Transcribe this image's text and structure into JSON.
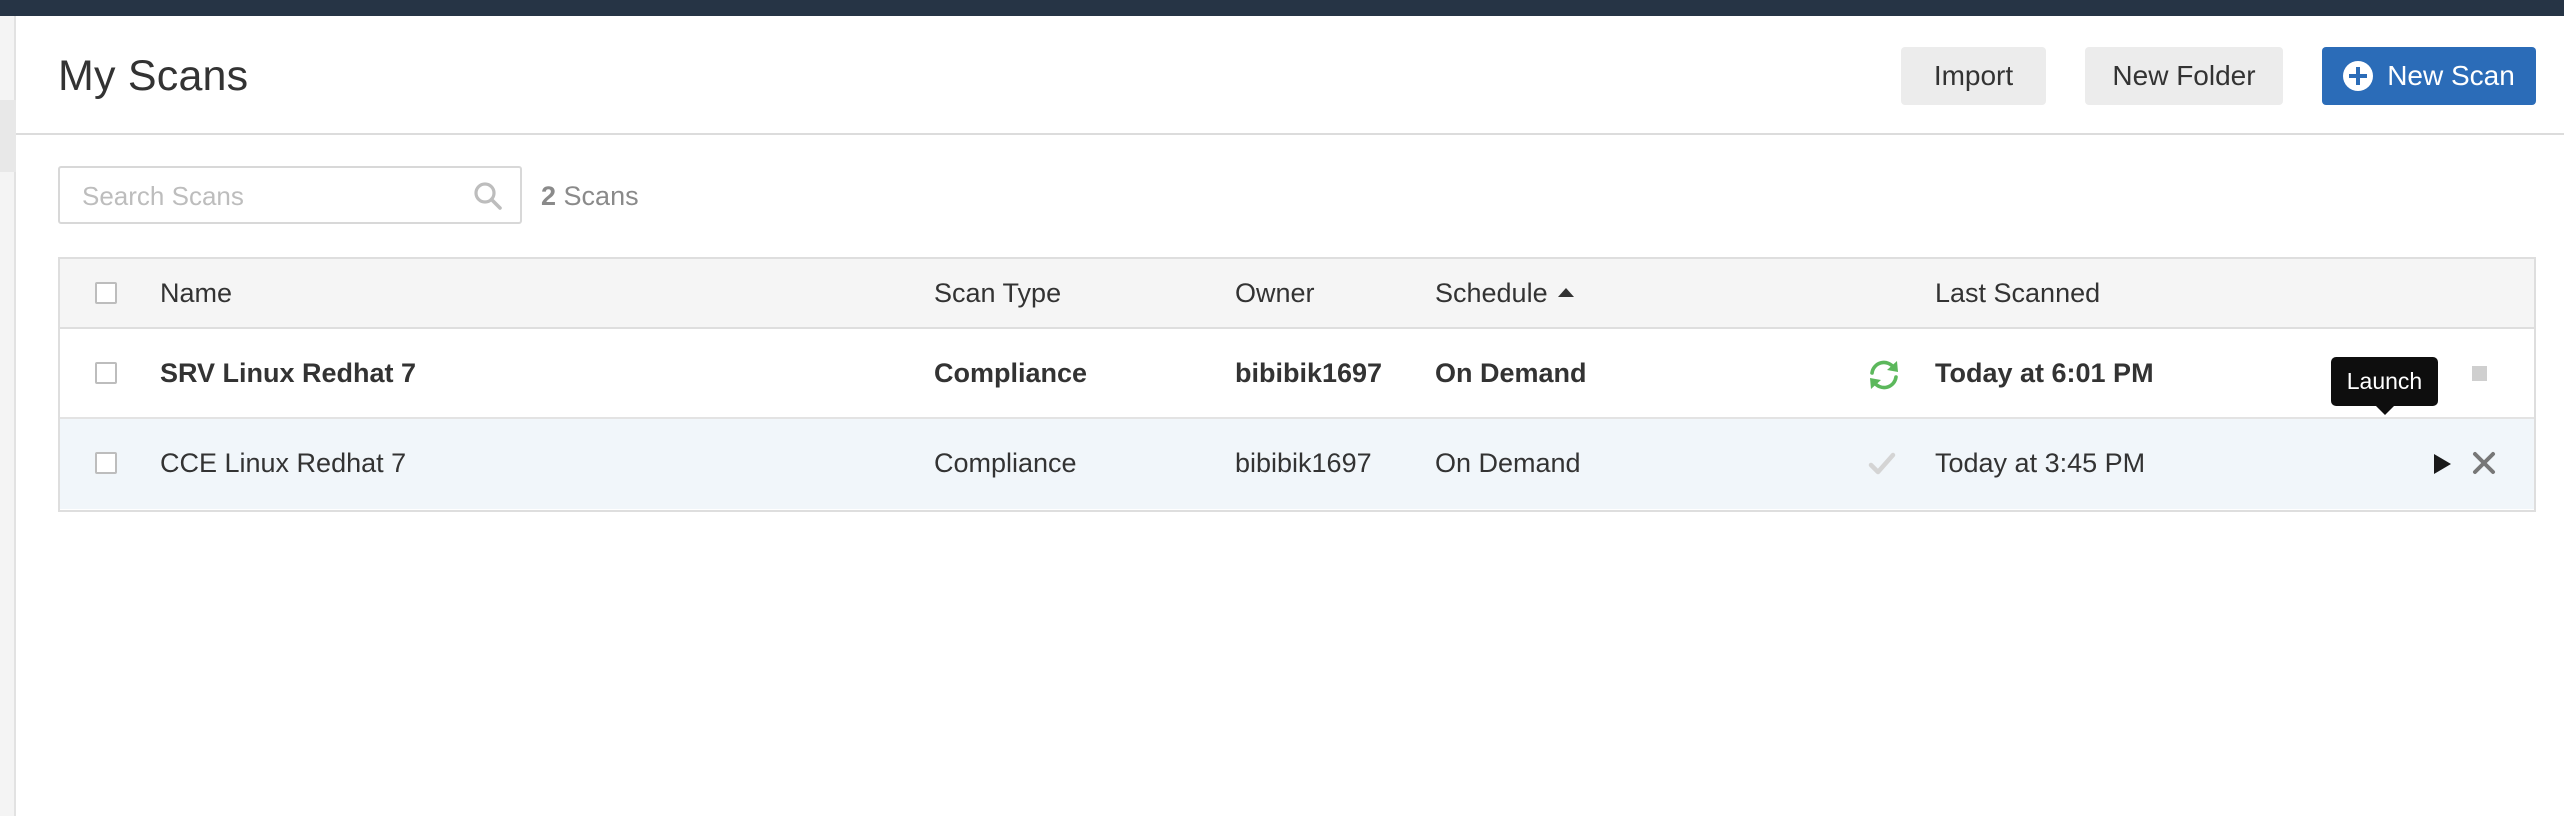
{
  "header": {
    "title": "My Scans",
    "import_label": "Import",
    "new_folder_label": "New Folder",
    "new_scan_label": "New Scan",
    "new_scan_icon": "plus-circle-icon"
  },
  "search": {
    "placeholder": "Search Scans",
    "value": "",
    "icon": "search-icon"
  },
  "scan_count": {
    "number": "2",
    "label": "Scans"
  },
  "table": {
    "columns": {
      "name": "Name",
      "scan_type": "Scan Type",
      "owner": "Owner",
      "schedule": "Schedule",
      "last_scanned": "Last Scanned"
    },
    "sort": {
      "column": "schedule",
      "direction": "ascending"
    },
    "rows": [
      {
        "name": "SRV Linux Redhat 7",
        "scan_type": "Compliance",
        "owner": "bibibik1697",
        "schedule": "On Demand",
        "status_icon": "refresh-icon",
        "last_scanned": "Today at 6:01 PM",
        "action_icon": "stop-icon"
      },
      {
        "name": "CCE Linux Redhat 7",
        "scan_type": "Compliance",
        "owner": "bibibik1697",
        "schedule": "On Demand",
        "status_icon": "check-icon",
        "last_scanned": "Today at 3:45 PM",
        "action_icon": "play-icon",
        "delete_icon": "close-icon"
      }
    ]
  },
  "tooltip": {
    "text": "Launch"
  },
  "colors": {
    "top_bar": "#263445",
    "primary": "#2b6cb8",
    "running_green": "#5cb85c",
    "hover_row": "#f1f6fa"
  }
}
